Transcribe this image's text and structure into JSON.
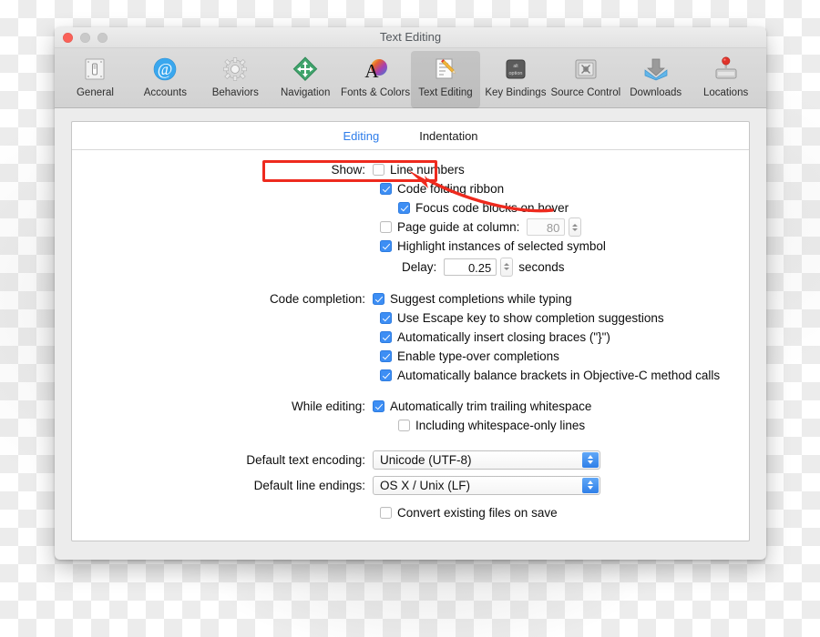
{
  "window": {
    "title": "Text Editing",
    "traffic_lights": [
      "close-button",
      "minimize-button",
      "zoom-button"
    ]
  },
  "toolbar": {
    "items": [
      {
        "label": "General",
        "icon": "switch-icon",
        "selected": false
      },
      {
        "label": "Accounts",
        "icon": "at-sign-icon",
        "selected": false
      },
      {
        "label": "Behaviors",
        "icon": "gear-icon",
        "selected": false
      },
      {
        "label": "Navigation",
        "icon": "move-arrows-icon",
        "selected": false
      },
      {
        "label": "Fonts & Colors",
        "icon": "font-color-icon",
        "selected": false
      },
      {
        "label": "Text Editing",
        "icon": "page-pencil-icon",
        "selected": true
      },
      {
        "label": "Key Bindings",
        "icon": "option-key-icon",
        "selected": false
      },
      {
        "label": "Source Control",
        "icon": "safe-icon",
        "selected": false
      },
      {
        "label": "Downloads",
        "icon": "download-tray-icon",
        "selected": false
      },
      {
        "label": "Locations",
        "icon": "hard-drive-icon",
        "selected": false
      }
    ]
  },
  "tabs": [
    {
      "label": "Editing",
      "active": true
    },
    {
      "label": "Indentation",
      "active": false
    }
  ],
  "form": {
    "show_label": "Show:",
    "line_numbers": "Line numbers",
    "code_folding_ribbon": "Code folding ribbon",
    "focus_code_blocks": "Focus code blocks on hover",
    "page_guide": "Page guide at column:",
    "page_guide_value": "80",
    "highlight_instances": "Highlight instances of selected symbol",
    "delay_label": "Delay:",
    "delay_value": "0.25",
    "delay_unit": "seconds",
    "code_completion_label": "Code completion:",
    "cc_suggest": "Suggest completions while typing",
    "cc_escape": "Use Escape key to show completion suggestions",
    "cc_braces": "Automatically insert closing braces (\"}\")",
    "cc_typeover": "Enable type-over completions",
    "cc_balance": "Automatically balance brackets in Objective-C method calls",
    "while_editing_label": "While editing:",
    "we_trim": "Automatically trim trailing whitespace",
    "we_including": "Including whitespace-only lines",
    "encoding_label": "Default text encoding:",
    "encoding_value": "Unicode (UTF-8)",
    "line_endings_label": "Default line endings:",
    "line_endings_value": "OS X / Unix (LF)",
    "convert_on_save": "Convert existing files on save"
  },
  "annotation": {
    "color": "#ee2a1e",
    "box_target": "Show: Line numbers",
    "arrow_points_to": "line-numbers-checkbox"
  }
}
